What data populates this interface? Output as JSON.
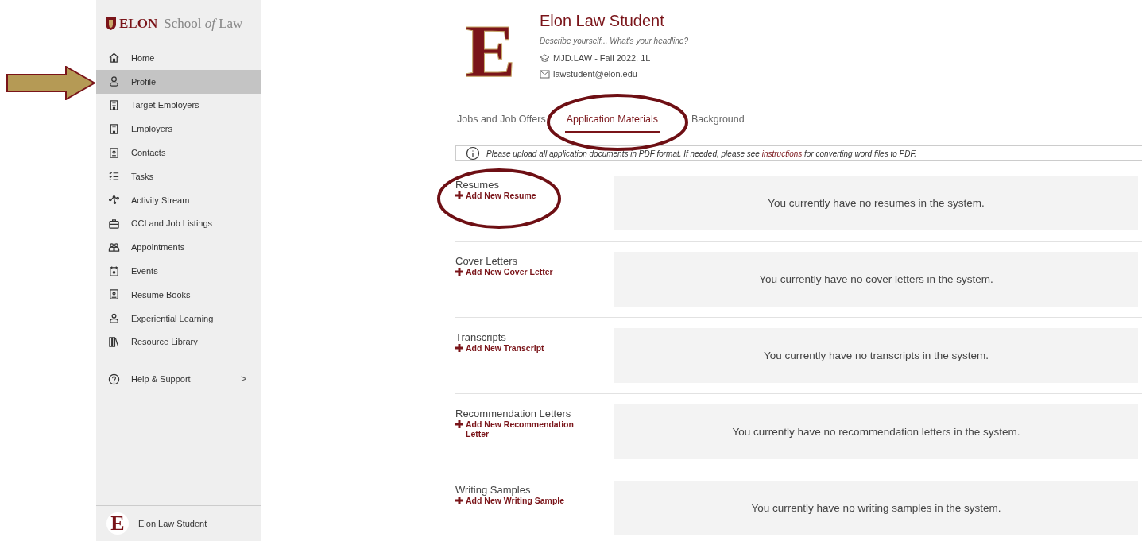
{
  "sidebar": {
    "logo": {
      "mark": "ELON",
      "sub_prefix": "School ",
      "sub_italic": "of",
      "sub_suffix": " Law"
    },
    "items": [
      {
        "label": "Home",
        "selected": false
      },
      {
        "label": "Profile",
        "selected": true
      },
      {
        "label": "Target Employers",
        "selected": false
      },
      {
        "label": "Employers",
        "selected": false
      },
      {
        "label": "Contacts",
        "selected": false
      },
      {
        "label": "Tasks",
        "selected": false
      },
      {
        "label": "Activity Stream",
        "selected": false
      },
      {
        "label": "OCI and Job Listings",
        "selected": false
      },
      {
        "label": "Appointments",
        "selected": false
      },
      {
        "label": "Events",
        "selected": false
      },
      {
        "label": "Resume Books",
        "selected": false
      },
      {
        "label": "Experiential Learning",
        "selected": false
      },
      {
        "label": "Resource Library",
        "selected": false
      }
    ],
    "help": {
      "label": "Help & Support",
      "chevron": ">"
    },
    "user": {
      "avatar_letter": "E",
      "name": "Elon Law Student"
    }
  },
  "profile": {
    "avatar_letter": "E",
    "name": "Elon Law Student",
    "headline_placeholder": "Describe yourself... What's your headline?",
    "program": "MJD.LAW - Fall 2022, 1L",
    "email": "lawstudent@elon.edu"
  },
  "tabs": [
    {
      "label": "Jobs and Job Offers",
      "selected": false
    },
    {
      "label": "Application Materials",
      "selected": true
    },
    {
      "label": "Background",
      "selected": false
    }
  ],
  "notice": {
    "before": "Please upload all application documents in PDF format. If needed, please see ",
    "link": "instructions",
    "after": " for converting word files to PDF."
  },
  "sections": [
    {
      "title": "Resumes",
      "add_label": "Add New Resume",
      "empty_message": "You currently have no resumes in the system."
    },
    {
      "title": "Cover Letters",
      "add_label": "Add New Cover Letter",
      "empty_message": "You currently have no cover letters in the system."
    },
    {
      "title": "Transcripts",
      "add_label": "Add New Transcript",
      "empty_message": "You currently have no transcripts in the system."
    },
    {
      "title": "Recommendation Letters",
      "add_label": "Add New Recommendation Letter",
      "empty_message": "You currently have no recommendation letters in the system."
    },
    {
      "title": "Writing Samples",
      "add_label": "Add New Writing Sample",
      "empty_message": "You currently have no writing samples in the system."
    }
  ]
}
